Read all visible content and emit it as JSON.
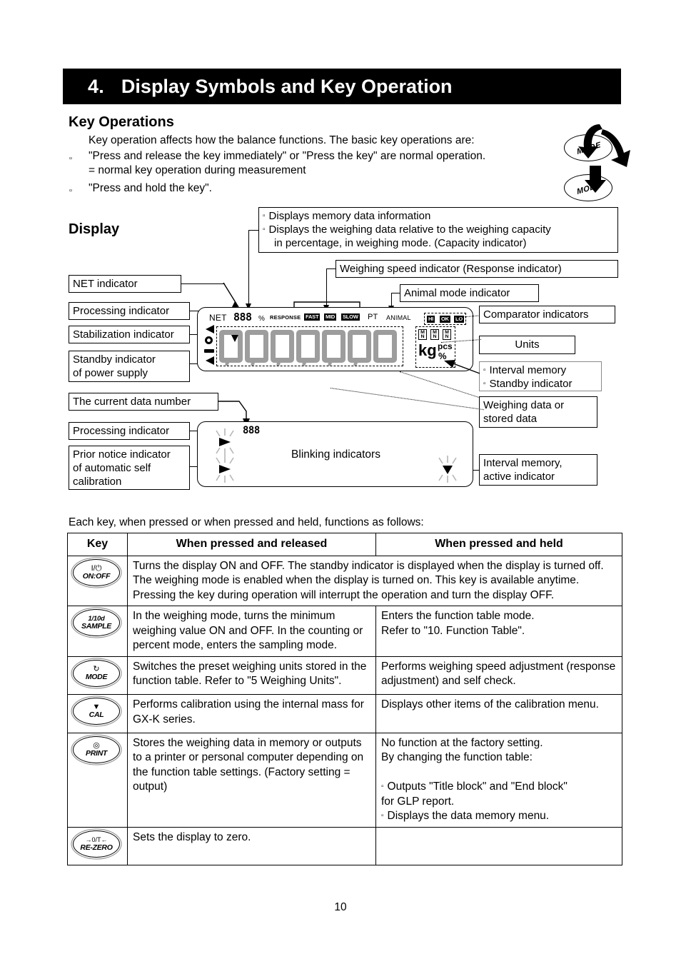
{
  "chapter": {
    "number": "4.",
    "title": "Display Symbols and Key Operation"
  },
  "key_operations": {
    "heading": "Key Operations",
    "intro": "Key operation affects how the balance functions. The basic key operations are:",
    "bullet_glyph": "▫",
    "items": [
      "\"Press and release the key immediately\" or \"Press the key\" are normal operation.",
      "= normal key operation during measurement",
      "\"Press and hold the key\"."
    ],
    "mode_illustration": {
      "top_label": "MODE",
      "bottom_label": "MODE"
    }
  },
  "display_section": {
    "heading": "Display",
    "callouts": {
      "memory_capacity": [
        "Displays memory data information",
        "Displays the weighing data relative to the weighing capacity",
        "in percentage, in weighing mode. (Capacity indicator)"
      ],
      "weighing_speed": "Weighing speed indicator (Response indicator)",
      "animal_mode": "Animal mode indicator",
      "net": "NET indicator",
      "processing_1": "Processing indicator",
      "stabilization": "Stabilization indicator",
      "standby_power": [
        "Standby indicator",
        "of power supply"
      ],
      "current_data_number": "The current data number",
      "processing_2": "Processing indicator",
      "self_cal": [
        "Prior notice indicator",
        "of automatic self",
        "calibration"
      ],
      "comparator": "Comparator indicators",
      "units": "Units",
      "interval_standby": [
        "Interval memory",
        "Standby indicator"
      ],
      "weighing_data": [
        "Weighing data or",
        "stored data"
      ],
      "interval_active": [
        "Interval memory,",
        "active indicator"
      ],
      "blinking": "Blinking indicators"
    },
    "lcd": {
      "net_label": "NET",
      "capacity_digits": "888",
      "percent_sign": "%",
      "response_label": "RESPONSE",
      "speed_options": [
        "FAST",
        "MID",
        "SLOW"
      ],
      "pt_label": "PT",
      "animal_label": "ANIMAL",
      "comparator_labels": [
        "HI",
        "OK",
        "LO"
      ],
      "unit_kg": "kg",
      "unit_pcs": "pcs",
      "unit_percent": "%",
      "mini_units": [
        {
          "top": "M",
          "bottom": "N"
        },
        {
          "top": "M",
          "bottom": "N"
        },
        {
          "top": "M",
          "bottom": "N"
        }
      ],
      "big_digits": [
        "8",
        "8",
        "8",
        "8",
        "8",
        "8",
        "8"
      ]
    },
    "blink_lcd": {
      "data_number_digits": "888"
    }
  },
  "table": {
    "intro": "Each key, when pressed or when pressed and held, functions as follows:",
    "headers": [
      "Key",
      "When pressed and released",
      "When pressed and held"
    ],
    "rows": [
      {
        "key": {
          "glyph": "I/⏻",
          "top": "",
          "bottom": "ON:OFF"
        },
        "pressed": "Turns the display ON and OFF. The standby indicator is displayed when the display is turned off. The weighing mode is enabled when the display is turned on. This key is available anytime. Pressing the key during operation will interrupt the operation and turn the display OFF.",
        "held": "",
        "span": true
      },
      {
        "key": {
          "glyph": "",
          "top": "1/10d",
          "bottom": "SAMPLE"
        },
        "pressed": "In the weighing mode, turns the minimum weighing value ON and OFF. In the counting or percent mode, enters the sampling mode.",
        "held": "Enters the function table mode.\nRefer to    \"10. Function Table\"."
      },
      {
        "key": {
          "glyph": "↻",
          "top": "",
          "bottom": "MODE"
        },
        "pressed": "Switches the preset weighing units stored in the function table. Refer to \"5 Weighing Units\".",
        "held": "Performs weighing speed adjustment (response adjustment) and self check."
      },
      {
        "key": {
          "glyph": "▼",
          "top": "",
          "bottom": "CAL"
        },
        "pressed": "Performs calibration using the internal mass for GX-K series.",
        "held": "Displays other items of the calibration menu."
      },
      {
        "key": {
          "glyph": "◎",
          "top": "",
          "bottom": "PRINT"
        },
        "pressed": "Stores the weighing data in memory or outputs to a printer or personal computer depending on the function table settings. (Factory setting = output)",
        "held_lines": [
          "No function at the factory setting.",
          "By changing the function table:"
        ],
        "held_bullets": [
          "Outputs \"Title block\" and \"End block\"\n   for GLP report.",
          "Displays the data memory menu."
        ]
      },
      {
        "key": {
          "glyph": "→0/T←",
          "top": "",
          "bottom": "RE-ZERO"
        },
        "pressed": "Sets the display to zero.",
        "held": ""
      }
    ]
  },
  "page_number": "10"
}
